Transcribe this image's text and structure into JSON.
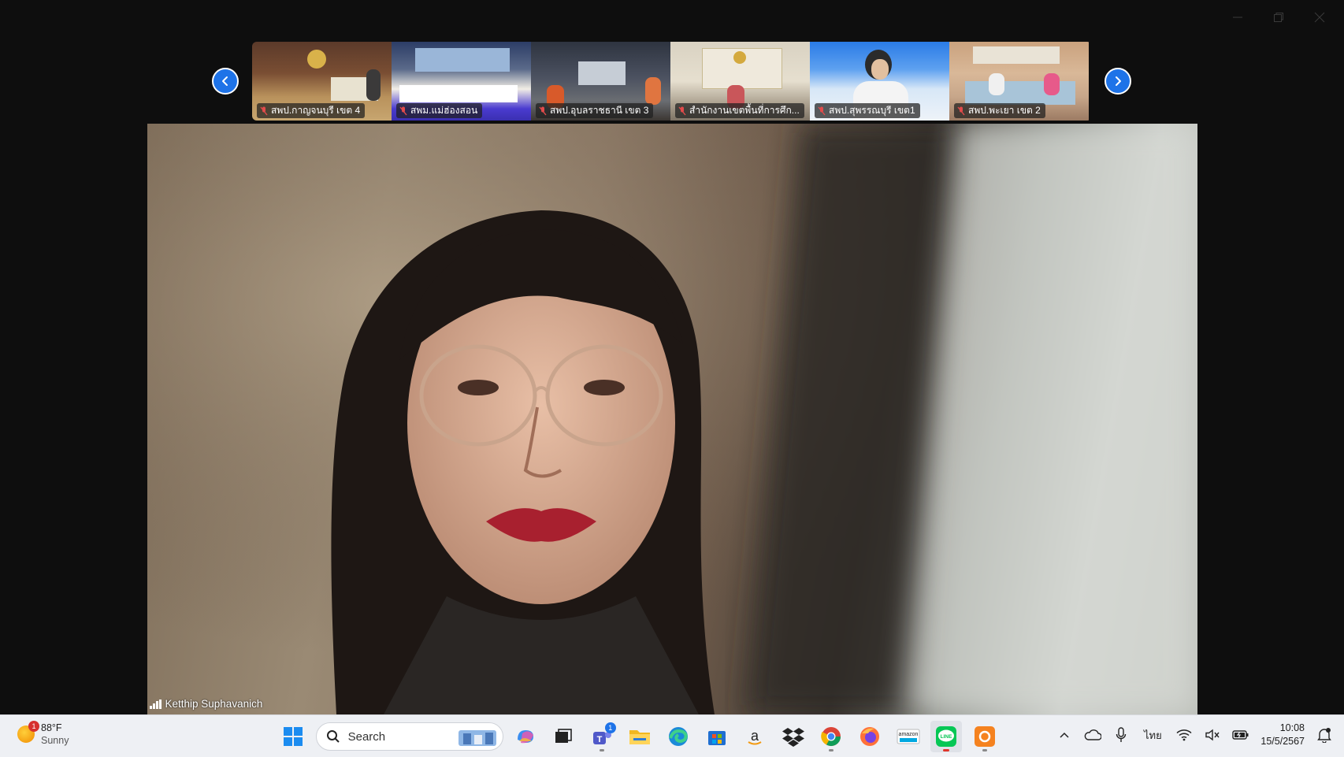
{
  "window": {
    "controls": [
      "minimize",
      "restore",
      "close"
    ]
  },
  "thumbnails": [
    {
      "label": "สพป.กาญจนบุรี เขต 4",
      "muted": true
    },
    {
      "label": "สพม.แม่ฮ่องสอน",
      "muted": true
    },
    {
      "label": "สพป.อุบลราชธานี เขต 3",
      "muted": true
    },
    {
      "label": "สำนักงานเขตพื้นที่การศึก...",
      "muted": true
    },
    {
      "label": "สพป.สุพรรณบุรี เขต1",
      "muted": true
    },
    {
      "label": "สพป.พะเยา เขต 2",
      "muted": true
    }
  ],
  "main_video": {
    "speaker": "Ketthip Suphavanich"
  },
  "taskbar": {
    "weather": {
      "temp": "88°F",
      "condition": "Sunny",
      "badge": "1"
    },
    "search_placeholder": "Search",
    "teams_badge": "1",
    "apps": [
      "windows-start",
      "search",
      "copilot",
      "task-view",
      "teams",
      "file-explorer",
      "edge",
      "microsoft-store",
      "amazon",
      "dropbox",
      "chrome",
      "firefox",
      "amazon-prime",
      "line",
      "orange-app"
    ],
    "tray": {
      "language": "ไทย"
    },
    "clock": {
      "time": "10:08",
      "date": "15/5/2567"
    }
  },
  "colors": {
    "accent": "#1e73e8",
    "background": "#0e0e0e",
    "taskbar": "#eef0f4"
  }
}
